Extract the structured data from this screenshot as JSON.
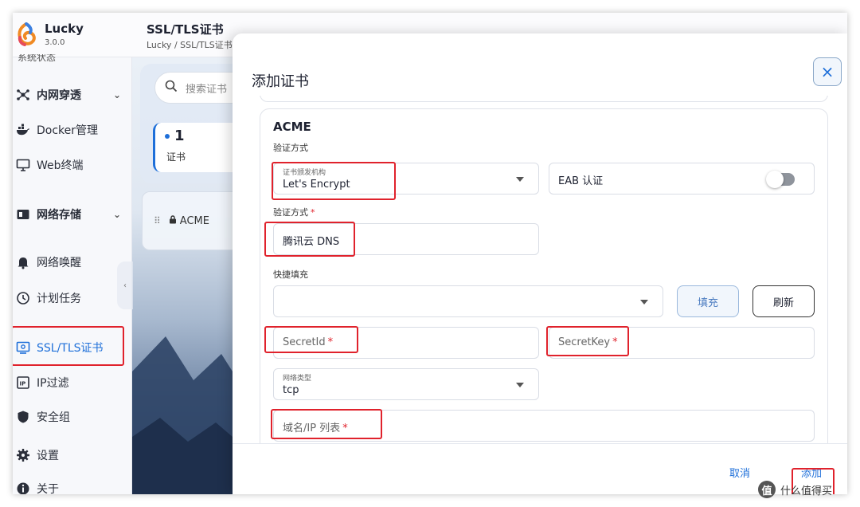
{
  "app": {
    "name": "Lucky",
    "version": "3.0.0"
  },
  "sidebar": {
    "cut_item": "系统状态",
    "items": [
      {
        "label": "内网穿透",
        "icon": "network-icon",
        "chevron": "⌄"
      },
      {
        "label": "Docker管理",
        "icon": "docker-icon"
      },
      {
        "label": "Web终端",
        "icon": "monitor-icon"
      },
      {
        "label": "网络存储",
        "icon": "storage-icon",
        "chevron": "⌄"
      },
      {
        "label": "网络唤醒",
        "icon": "bell-icon"
      },
      {
        "label": "计划任务",
        "icon": "clock-icon"
      },
      {
        "label": "SSL/TLS证书",
        "icon": "certificate-icon"
      },
      {
        "label": "IP过滤",
        "icon": "ip-filter-icon"
      },
      {
        "label": "安全组",
        "icon": "shield-icon"
      },
      {
        "label": "设置",
        "icon": "gear-icon"
      },
      {
        "label": "关于",
        "icon": "info-icon"
      }
    ]
  },
  "header": {
    "title": "SSL/TLS证书",
    "breadcrumb": "Lucky / SSL/TLS证书"
  },
  "list_panel": {
    "search_placeholder": "搜索证书",
    "count_value": "1",
    "count_label": "证书",
    "card_label": "ACME",
    "collapse_glyph": "‹"
  },
  "modal": {
    "title": "添加证书",
    "close_glyph": "×",
    "section_title": "ACME",
    "verify_method_label": "验证方式",
    "ca_field": {
      "top_label": "证书颁发机构",
      "value": "Let's Encrypt"
    },
    "eab_field": {
      "label": "EAB 认证"
    },
    "dns_label": "验证方式",
    "dns_value": "腾讯云 DNS",
    "quick_fill_label": "快捷填充",
    "fill_button": "填充",
    "refresh_button": "刷新",
    "secret_id_placeholder": "SecretId",
    "secret_key_placeholder": "SecretKey",
    "network_field": {
      "top_label": "网络类型",
      "value": "tcp"
    },
    "domain_placeholder": "域名/IP 列表",
    "required_mark": "*",
    "cancel_button": "取消",
    "add_button": "添加"
  },
  "watermark": {
    "badge": "值",
    "text": "什么值得买"
  },
  "colors": {
    "accent": "#1e6fd9",
    "highlight_box": "#e0222c"
  }
}
